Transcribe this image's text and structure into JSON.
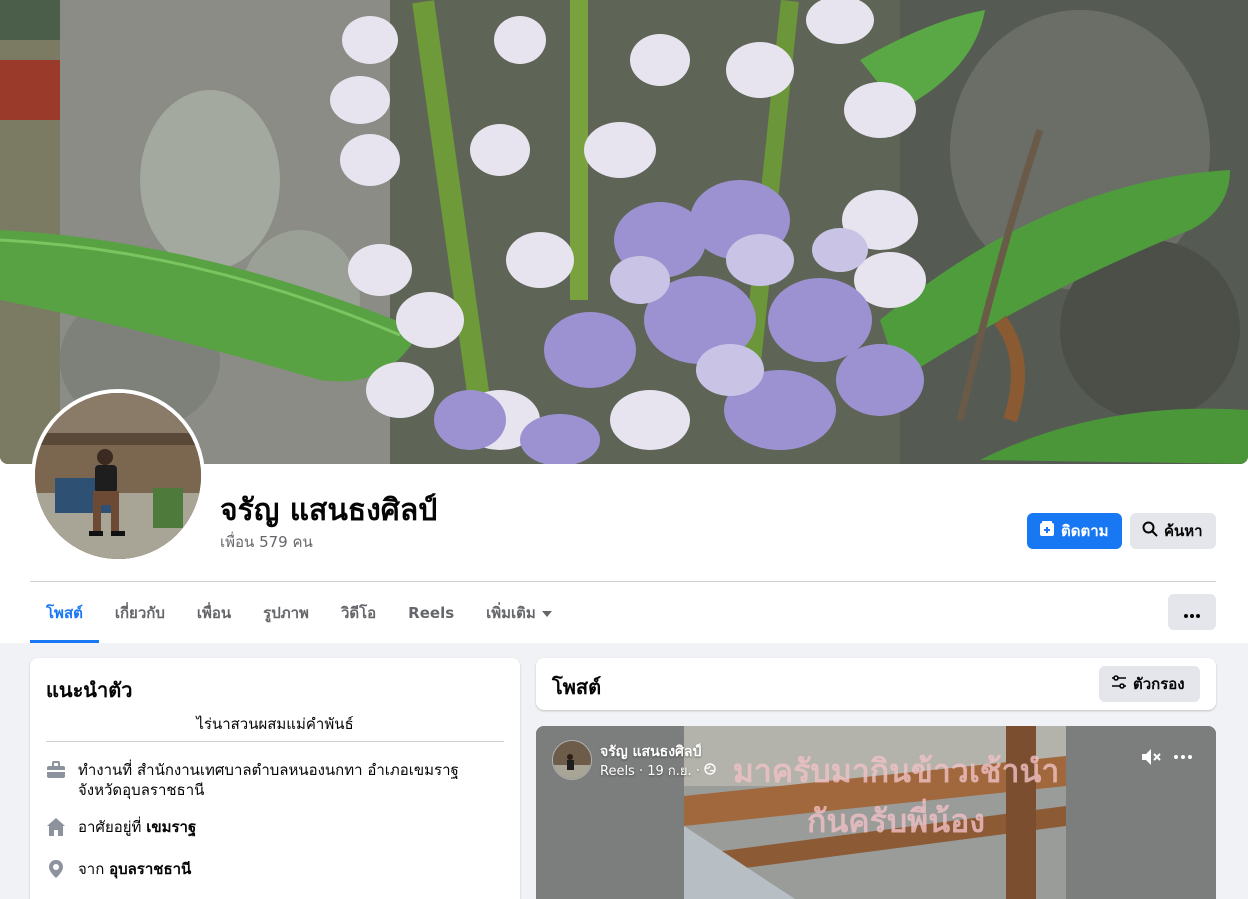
{
  "profile": {
    "name": "จรัญ แสนธงศิลป์",
    "friends_label": "เพื่อน",
    "friends_count": "579",
    "friends_unit": "คน"
  },
  "actions": {
    "follow_label": "ติดตาม",
    "search_label": "ค้นหา"
  },
  "tabs": [
    {
      "label": "โพสต์",
      "active": true
    },
    {
      "label": "เกี่ยวกับ"
    },
    {
      "label": "เพื่อน"
    },
    {
      "label": "รูปภาพ"
    },
    {
      "label": "วิดีโอ"
    },
    {
      "label": "Reels"
    },
    {
      "label": "เพิ่มเติม"
    }
  ],
  "intro": {
    "title": "แนะนำตัว",
    "bio": "ไร่นาสวนผสมแม่คำพันธ์",
    "work_prefix": "ทำงานที่",
    "work_place": "สำนักงานเทศบาลตำบลหนองนกทา อำเภอเขมราฐ จังหวัดอุบลราชธานี",
    "lives_prefix": "อาศัยอยู่ที่",
    "lives_place": "เขมราฐ",
    "from_prefix": "จาก",
    "from_place": "อุบลราชธานี"
  },
  "posts": {
    "title": "โพสต์",
    "filter_label": "ตัวกรอง"
  },
  "reel": {
    "author": "จรัญ แสนธงศิลป์",
    "meta": "Reels · 19 ก.ย. ·",
    "caption": "มาครับมากินข้าวเช้านำกันครับพี่น้อง"
  },
  "icons": {
    "follow": "follow-plus-icon",
    "search": "search-icon",
    "more": "more-dots-icon",
    "dropdown": "caret-down-icon",
    "filter": "filter-sliders-icon",
    "work": "briefcase-icon",
    "home": "home-icon",
    "location": "location-pin-icon",
    "globe": "public-globe-icon",
    "mute": "speaker-muted-icon"
  },
  "colors": {
    "accent": "#1877f2",
    "page_bg": "#f0f2f5",
    "secondary_button": "#e4e6eb",
    "secondary_text": "#65676b"
  }
}
